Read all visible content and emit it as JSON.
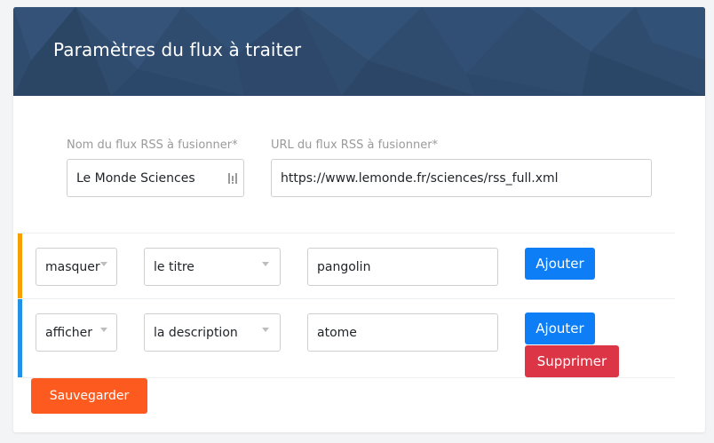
{
  "header": {
    "title": "Paramètres du flux à traiter"
  },
  "form": {
    "name_label": "Nom du flux RSS à fusionner*",
    "name_value": "Le Monde Sciences",
    "url_label": "URL du flux RSS à fusionner*",
    "url_value": "https://www.lemonde.fr/sciences/rss_full.xml"
  },
  "filters": [
    {
      "accent_color": "#f5a000",
      "action": "masquer",
      "field": "le titre",
      "keyword": "pangolin",
      "add_label": "Ajouter"
    },
    {
      "accent_color": "#2291e6",
      "action": "afficher",
      "field": "la description",
      "keyword": "atome",
      "add_label": "Ajouter",
      "delete_label": "Supprimer"
    }
  ],
  "save_label": "Sauvegarder",
  "icons": {
    "password_manager": "password-manager-icon",
    "dropdown": "chevron-down-icon"
  },
  "colors": {
    "header_bg": "#2f4b6e",
    "primary": "#0d7ef6",
    "danger": "#dc3545",
    "save": "#fc5a1f"
  }
}
